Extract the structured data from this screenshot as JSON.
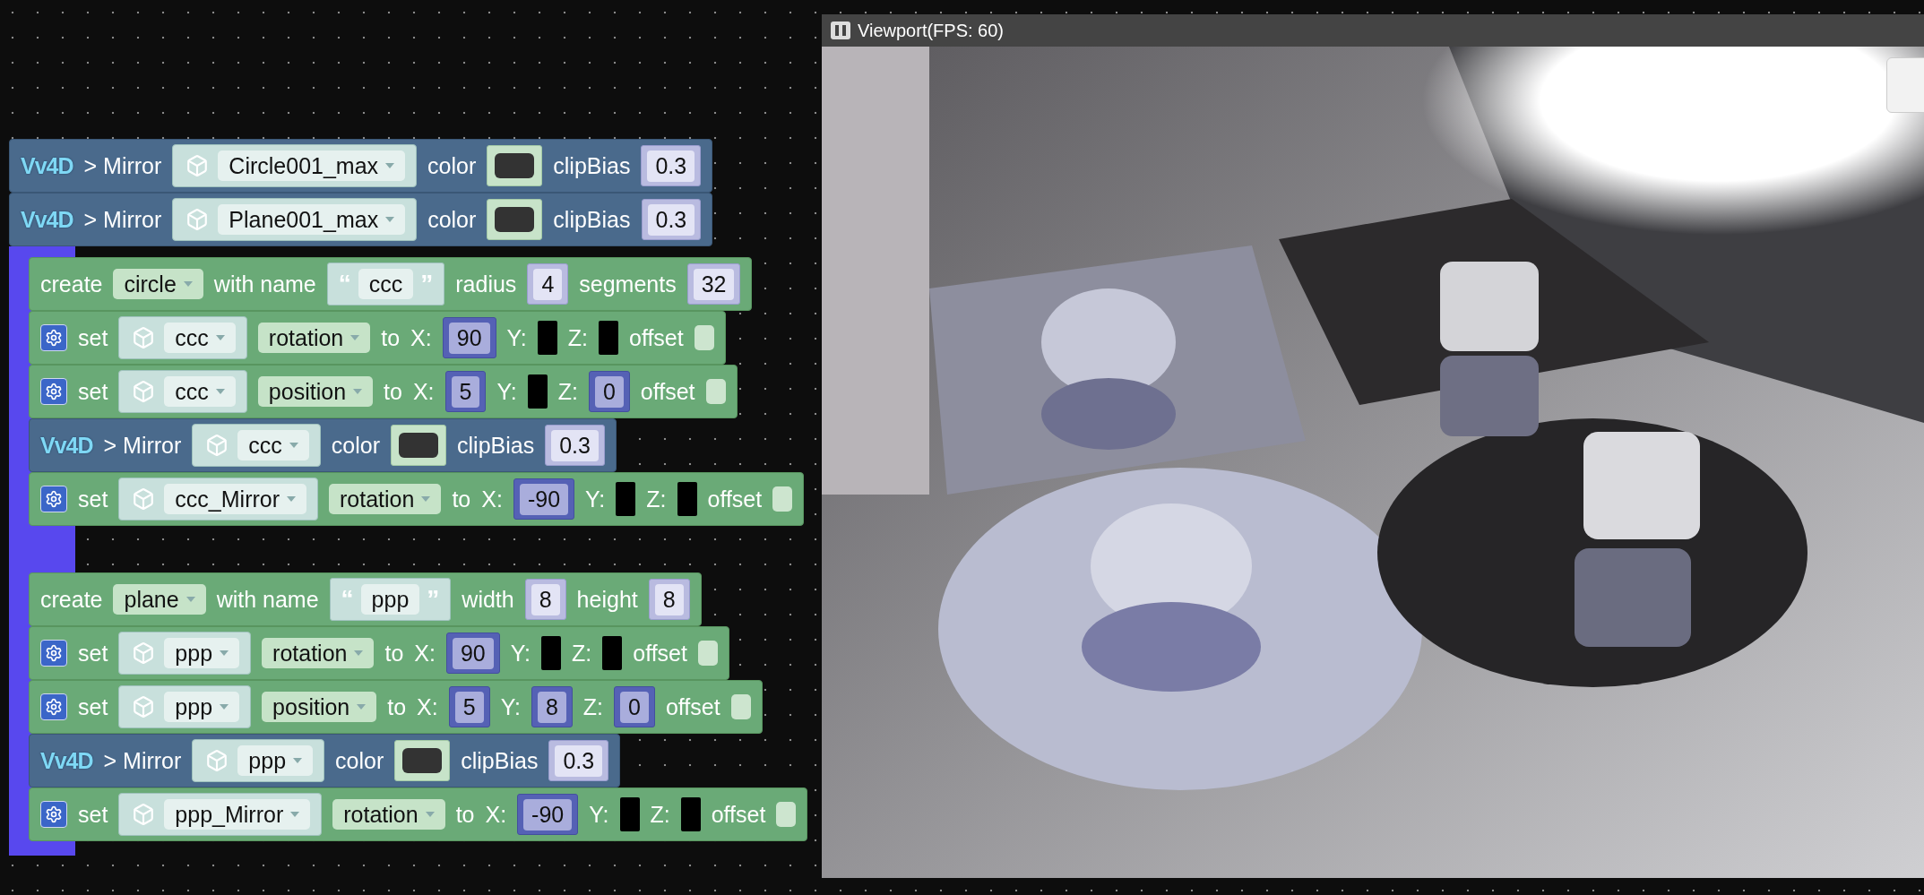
{
  "viewport": {
    "title": "Viewport(FPS: 60)"
  },
  "top_blocks": [
    {
      "kind": "mirror",
      "logo": "Vv4D",
      "label": "> Mirror",
      "object": "Circle001_max",
      "color_label": "color",
      "bias_label": "clipBias",
      "bias": "0.3"
    },
    {
      "kind": "mirror",
      "logo": "Vv4D",
      "label": "> Mirror",
      "object": "Plane001_max",
      "color_label": "color",
      "bias_label": "clipBias",
      "bias": "0.3"
    }
  ],
  "groups": [
    {
      "blocks": [
        {
          "kind": "create",
          "verb": "create",
          "shape": "circle",
          "with": "with name",
          "open_quote": "“",
          "name": "ccc",
          "close_quote": "”",
          "params": [
            {
              "label": "radius",
              "value": "4"
            },
            {
              "label": "segments",
              "value": "32"
            }
          ]
        },
        {
          "kind": "set",
          "verb": "set",
          "object": "ccc",
          "property": "rotation",
          "to": "to",
          "axes": [
            {
              "label": "X:",
              "value": "90"
            },
            {
              "label": "Y:"
            },
            {
              "label": "Z:"
            }
          ],
          "offset": "offset",
          "checked": false
        },
        {
          "kind": "set",
          "verb": "set",
          "object": "ccc",
          "property": "position",
          "to": "to",
          "axes": [
            {
              "label": "X:",
              "value": "5"
            },
            {
              "label": "Y:"
            },
            {
              "label": "Z:",
              "value": "0"
            }
          ],
          "offset": "offset",
          "checked": false
        },
        {
          "kind": "mirror",
          "logo": "Vv4D",
          "label": "> Mirror",
          "object": "ccc",
          "color_label": "color",
          "bias_label": "clipBias",
          "bias": "0.3"
        },
        {
          "kind": "set",
          "verb": "set",
          "object": "ccc_Mirror",
          "property": "rotation",
          "to": "to",
          "axes": [
            {
              "label": "X:",
              "value": "-90"
            },
            {
              "label": "Y:"
            },
            {
              "label": "Z:"
            }
          ],
          "offset": "offset",
          "checked": false
        }
      ]
    },
    {
      "blocks": [
        {
          "kind": "create",
          "verb": "create",
          "shape": "plane",
          "with": "with name",
          "open_quote": "“",
          "name": "ppp",
          "close_quote": "”",
          "params": [
            {
              "label": "width",
              "value": "8"
            },
            {
              "label": "height",
              "value": "8"
            }
          ]
        },
        {
          "kind": "set",
          "verb": "set",
          "object": "ppp",
          "property": "rotation",
          "to": "to",
          "axes": [
            {
              "label": "X:",
              "value": "90"
            },
            {
              "label": "Y:"
            },
            {
              "label": "Z:"
            }
          ],
          "offset": "offset",
          "checked": false
        },
        {
          "kind": "set",
          "verb": "set",
          "object": "ppp",
          "property": "position",
          "to": "to",
          "axes": [
            {
              "label": "X:",
              "value": "5"
            },
            {
              "label": "Y:",
              "value": "8"
            },
            {
              "label": "Z:",
              "value": "0"
            }
          ],
          "offset": "offset",
          "checked": false
        },
        {
          "kind": "mirror",
          "logo": "Vv4D",
          "label": "> Mirror",
          "object": "ppp",
          "color_label": "color",
          "bias_label": "clipBias",
          "bias": "0.3"
        },
        {
          "kind": "set",
          "verb": "set",
          "object": "ppp_Mirror",
          "property": "rotation",
          "to": "to",
          "axes": [
            {
              "label": "X:",
              "value": "-90"
            },
            {
              "label": "Y:"
            },
            {
              "label": "Z:"
            }
          ],
          "offset": "offset",
          "checked": false
        }
      ]
    }
  ]
}
